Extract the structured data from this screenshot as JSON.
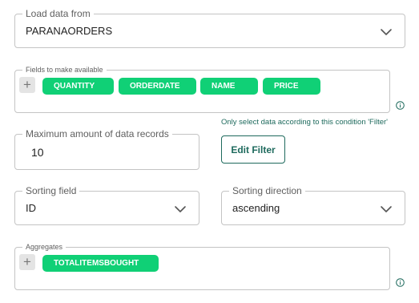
{
  "load_data": {
    "label": "Load data from",
    "value": "PARANAORDERS",
    "chevron_icon": "chevron-down-icon"
  },
  "fields": {
    "label": "Fields to make available",
    "add_icon": "plus-icon",
    "chips": [
      "QUANTITY",
      "ORDERDATE",
      "NAME",
      "PRICE"
    ],
    "info_icon": "info-icon"
  },
  "filter": {
    "note": "Only select data according to this condition 'Filter'",
    "button_label": "Edit Filter"
  },
  "max_records": {
    "label": "Maximum amount of data records",
    "value": "10"
  },
  "sorting_field": {
    "label": "Sorting field",
    "value": "ID",
    "chevron_icon": "chevron-down-icon"
  },
  "sorting_direction": {
    "label": "Sorting direction",
    "value": "ascending",
    "chevron_icon": "chevron-down-icon"
  },
  "aggregates": {
    "label": "Aggregates",
    "add_icon": "plus-icon",
    "chips": [
      "TOTALITEMSBOUGHT"
    ],
    "info_icon": "info-icon"
  },
  "colors": {
    "chip_green": "#10d076",
    "accent_teal": "#1e6a5d",
    "border_grey": "#c4c4c4"
  }
}
